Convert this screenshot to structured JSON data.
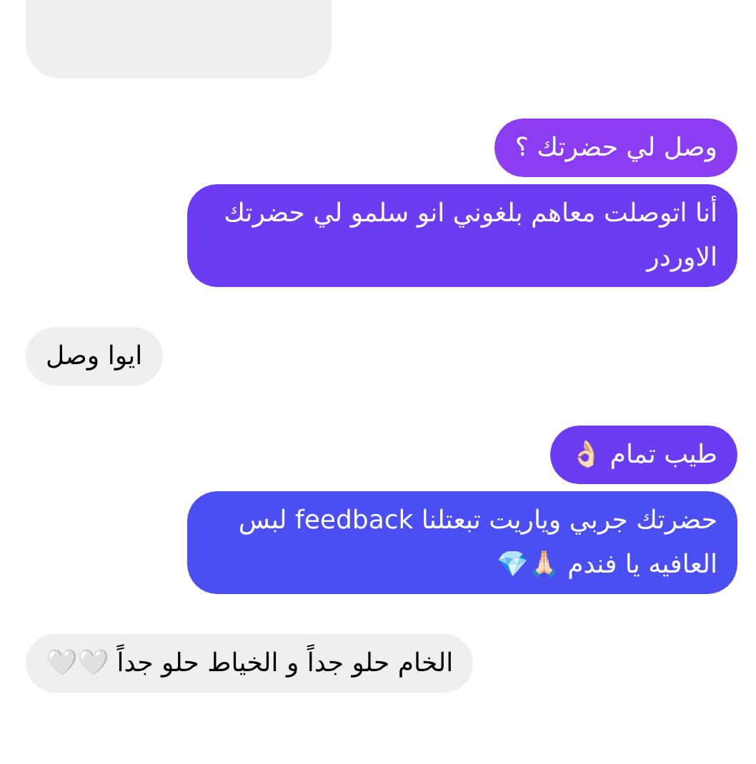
{
  "messages": [
    {
      "kind": "received"
    },
    {
      "kind": "sent",
      "text": "وصل لي حضرتك ؟",
      "color": "#8b3df2"
    },
    {
      "kind": "sent",
      "text": "أنا اتوصلت معاهم بلغوني انو سلمو لي حضرتك الاوردر",
      "color": "#6c3cf3"
    },
    {
      "kind": "received",
      "text": "ايوا وصل"
    },
    {
      "kind": "sent",
      "text": "طيب تمام 👌🏻",
      "color": "#6a3cf2"
    },
    {
      "kind": "sent",
      "text": "حضرتك جربي وياريت تبعتلنا feedback لبس العافيه يا فندم 🙏🏻💎",
      "color": "#4b4ef1"
    },
    {
      "kind": "received",
      "text": "الخام حلو جداً و الخياط حلو جداً 🤍🤍"
    }
  ]
}
